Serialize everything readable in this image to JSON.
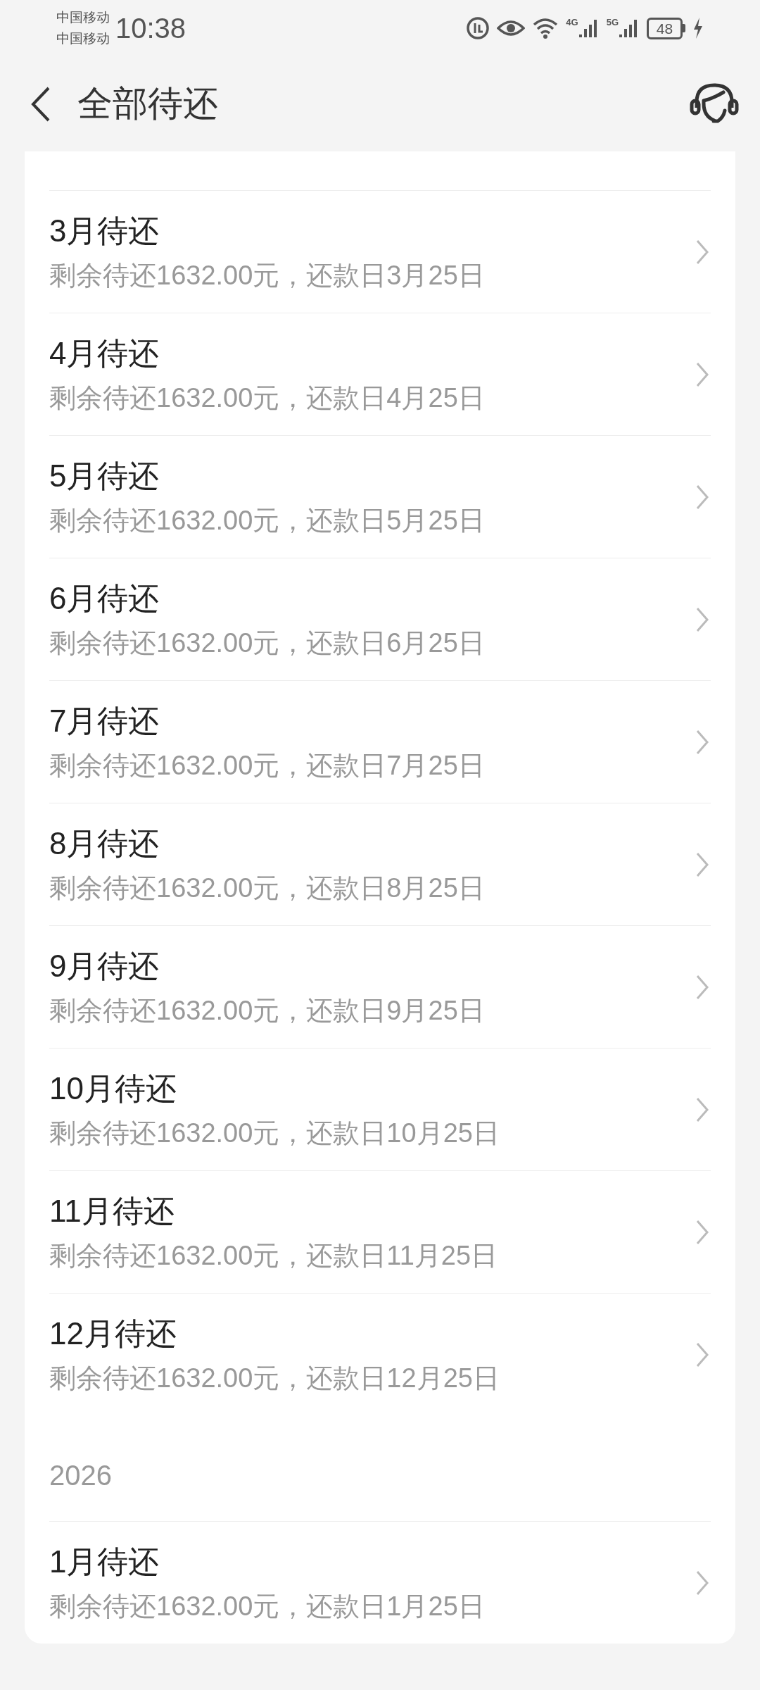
{
  "status_bar": {
    "carriers": [
      "中国移动",
      "中国移动"
    ],
    "time": "10:38",
    "networks": [
      "4G",
      "5G"
    ],
    "battery": "48"
  },
  "header": {
    "title": "全部待还"
  },
  "sections": [
    {
      "items": [
        {
          "title": "3月待还",
          "detail": "剩余待还1632.00元，还款日3月25日"
        },
        {
          "title": "4月待还",
          "detail": "剩余待还1632.00元，还款日4月25日"
        },
        {
          "title": "5月待还",
          "detail": "剩余待还1632.00元，还款日5月25日"
        },
        {
          "title": "6月待还",
          "detail": "剩余待还1632.00元，还款日6月25日"
        },
        {
          "title": "7月待还",
          "detail": "剩余待还1632.00元，还款日7月25日"
        },
        {
          "title": "8月待还",
          "detail": "剩余待还1632.00元，还款日8月25日"
        },
        {
          "title": "9月待还",
          "detail": "剩余待还1632.00元，还款日9月25日"
        },
        {
          "title": "10月待还",
          "detail": "剩余待还1632.00元，还款日10月25日"
        },
        {
          "title": "11月待还",
          "detail": "剩余待还1632.00元，还款日11月25日"
        },
        {
          "title": "12月待还",
          "detail": "剩余待还1632.00元，还款日12月25日"
        }
      ]
    },
    {
      "year": "2026",
      "items": [
        {
          "title": "1月待还",
          "detail": "剩余待还1632.00元，还款日1月25日"
        }
      ]
    }
  ]
}
